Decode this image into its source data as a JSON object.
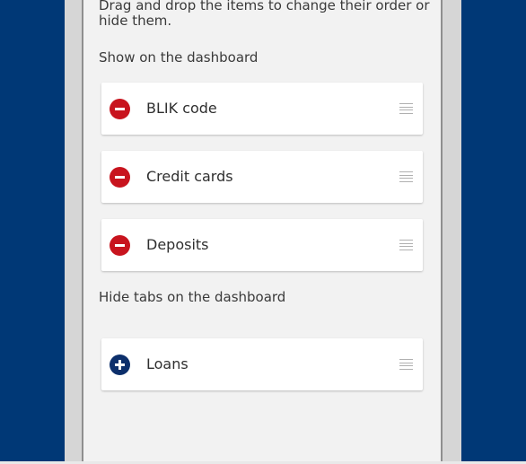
{
  "instructions": "Drag and drop the items to change their order or hide them.",
  "show_section": {
    "title": "Show on the dashboard",
    "items": [
      {
        "label": "BLIK code",
        "action_icon": "remove-circle-icon"
      },
      {
        "label": "Credit cards",
        "action_icon": "remove-circle-icon"
      },
      {
        "label": "Deposits",
        "action_icon": "remove-circle-icon"
      }
    ]
  },
  "hide_section": {
    "title": "Hide tabs on the dashboard",
    "items": [
      {
        "label": "Loans",
        "action_icon": "add-circle-icon"
      }
    ]
  },
  "colors": {
    "background": "#003876",
    "remove": "#c8141e",
    "add": "#0c2f6b"
  },
  "icons": {
    "drag": "drag-handle-icon"
  }
}
